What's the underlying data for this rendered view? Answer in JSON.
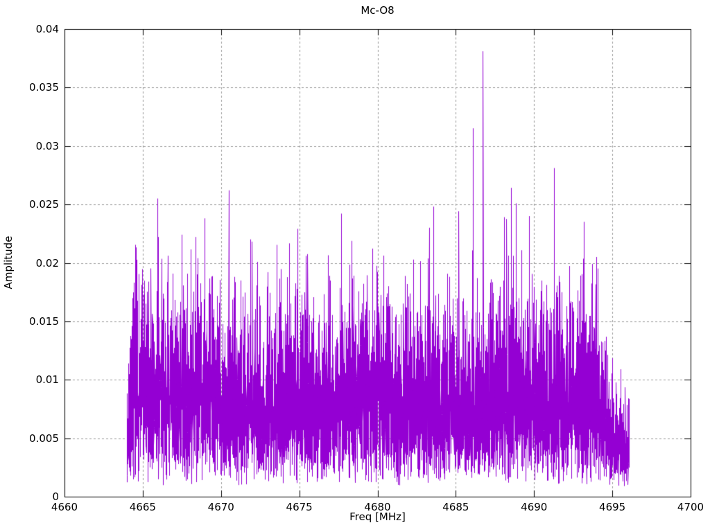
{
  "chart_data": {
    "type": "line",
    "title": "Mc-O8",
    "xlabel": "Freq [MHz]",
    "ylabel": "Amplitude",
    "xlim": [
      4660,
      4700
    ],
    "ylim": [
      0,
      0.04
    ],
    "xticks": [
      4660,
      4665,
      4670,
      4675,
      4680,
      4685,
      4690,
      4695,
      4700
    ],
    "xtick_labels": [
      "4660",
      "4665",
      "4670",
      "4675",
      "4680",
      "4685",
      "4690",
      "4695",
      "4700"
    ],
    "yticks": [
      0,
      0.005,
      0.01,
      0.015,
      0.02,
      0.025,
      0.03,
      0.035,
      0.04
    ],
    "ytick_labels": [
      "0",
      "0.005",
      "0.01",
      "0.015",
      "0.02",
      "0.025",
      "0.03",
      "0.035",
      "0.04"
    ],
    "grid": true,
    "legend": "none",
    "line_color": "#9400d3",
    "grid_color": "#9a9a9a",
    "axis_color": "#000000",
    "text_color": "#000000",
    "background": "#ffffff",
    "signal": {
      "description": "dense noise-like spectrum band",
      "freq_start": 4664.0,
      "freq_end": 4696.1,
      "num_points": 6000,
      "noise_floor_min": 0.0008,
      "noise_mean": 0.008,
      "dense_band_top": 0.015,
      "typical_spike_max": 0.023,
      "edge_ramp_mhz": 0.35,
      "right_taper_start": 4693.6,
      "right_taper_factor": 0.55,
      "seed": 7
    },
    "peaks": [
      {
        "freq": 4666.0,
        "amp": 0.0222
      },
      {
        "freq": 4666.6,
        "amp": 0.0206
      },
      {
        "freq": 4667.5,
        "amp": 0.0205
      },
      {
        "freq": 4668.4,
        "amp": 0.0222
      },
      {
        "freq": 4670.5,
        "amp": 0.0262
      },
      {
        "freq": 4671.9,
        "amp": 0.022
      },
      {
        "freq": 4674.9,
        "amp": 0.0229
      },
      {
        "freq": 4677.7,
        "amp": 0.0242
      },
      {
        "freq": 4683.3,
        "amp": 0.023
      },
      {
        "freq": 4683.6,
        "amp": 0.0248
      },
      {
        "freq": 4685.2,
        "amp": 0.0244
      },
      {
        "freq": 4686.1,
        "amp": 0.0315
      },
      {
        "freq": 4686.75,
        "amp": 0.0381
      },
      {
        "freq": 4688.1,
        "amp": 0.0239
      },
      {
        "freq": 4689.7,
        "amp": 0.024
      },
      {
        "freq": 4691.3,
        "amp": 0.0281
      },
      {
        "freq": 4693.2,
        "amp": 0.0235
      },
      {
        "freq": 4694.0,
        "amp": 0.0205
      }
    ]
  }
}
